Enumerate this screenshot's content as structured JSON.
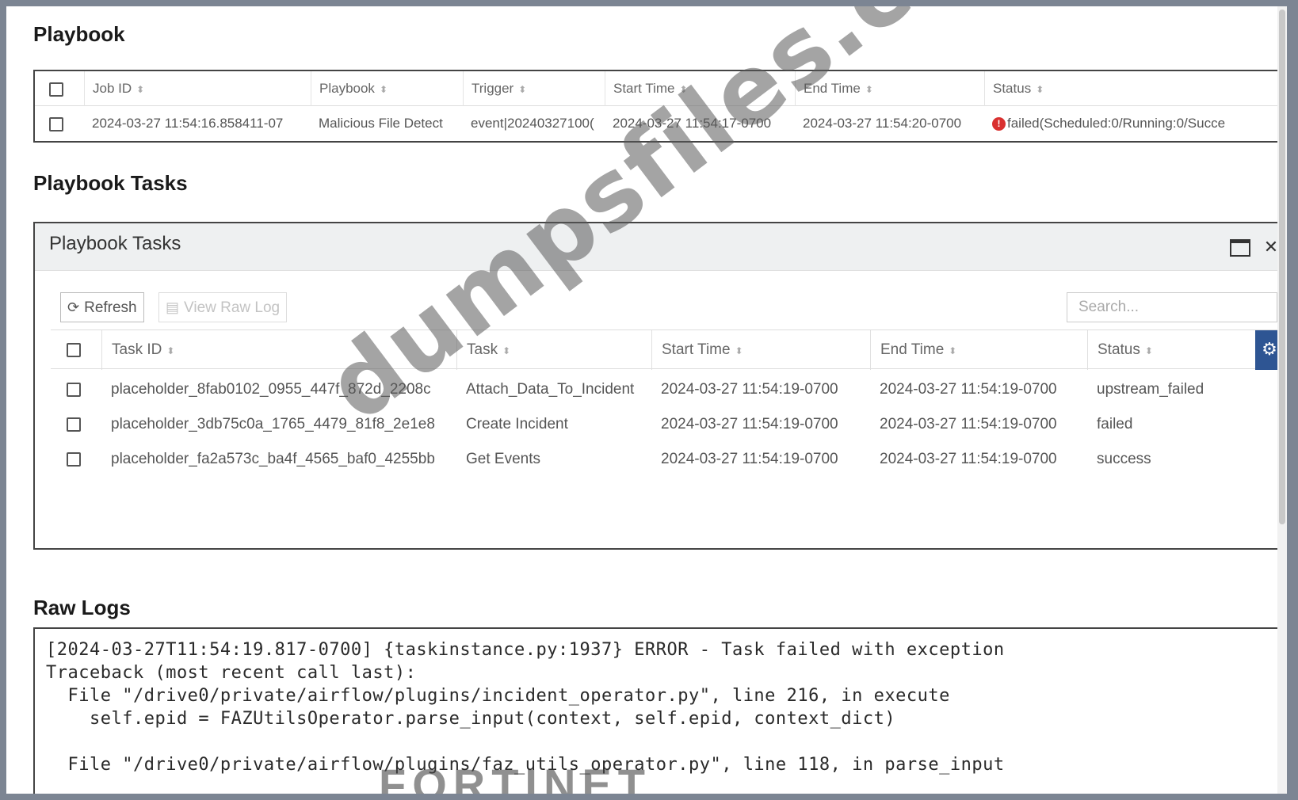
{
  "sections": {
    "playbook_title": "Playbook",
    "tasks_title": "Playbook Tasks",
    "raw_logs_title": "Raw Logs"
  },
  "playbook_table": {
    "columns": [
      "Job ID",
      "Playbook",
      "Trigger",
      "Start Time",
      "End Time",
      "Status"
    ],
    "row": {
      "job_id": "2024-03-27 11:54:16.858411-07",
      "playbook": "Malicious File Detect",
      "trigger": "event|20240327100(",
      "start_time": "2024-03-27 11:54:17-0700",
      "end_time": "2024-03-27 11:54:20-0700",
      "status": "failed(Scheduled:0/Running:0/Succe"
    }
  },
  "tasks_panel": {
    "header_title": "Playbook Tasks",
    "refresh_label": "Refresh",
    "view_raw_log_label": "View Raw Log",
    "search_placeholder": "Search...",
    "columns": [
      "Task ID",
      "Task",
      "Start Time",
      "End Time",
      "Status"
    ],
    "rows": [
      {
        "task_id": "placeholder_8fab0102_0955_447f_872d_2208c",
        "task": "Attach_Data_To_Incident",
        "start": "2024-03-27 11:54:19-0700",
        "end": "2024-03-27 11:54:19-0700",
        "status": "upstream_failed"
      },
      {
        "task_id": "placeholder_3db75c0a_1765_4479_81f8_2e1e8",
        "task": "Create Incident",
        "start": "2024-03-27 11:54:19-0700",
        "end": "2024-03-27 11:54:19-0700",
        "status": "failed"
      },
      {
        "task_id": "placeholder_fa2a573c_ba4f_4565_baf0_4255bb",
        "task": "Get Events",
        "start": "2024-03-27 11:54:19-0700",
        "end": "2024-03-27 11:54:19-0700",
        "status": "success"
      }
    ]
  },
  "raw_logs": {
    "lines": [
      "[2024-03-27T11:54:19.817-0700] {taskinstance.py:1937} ERROR - Task failed with exception",
      "Traceback (most recent call last):",
      "  File \"/drive0/private/airflow/plugins/incident_operator.py\", line 216, in execute",
      "    self.epid = FAZUtilsOperator.parse_input(context, self.epid, context_dict)",
      "",
      "  File \"/drive0/private/airflow/plugins/faz_utils_operator.py\", line 118, in parse_input"
    ]
  },
  "overlays": {
    "watermark": "dumpsfiles.com",
    "brand": "FORTINET"
  },
  "colors": {
    "accent": "#2e5593",
    "error": "#d9302f",
    "panel_header": "#eef0f1"
  }
}
